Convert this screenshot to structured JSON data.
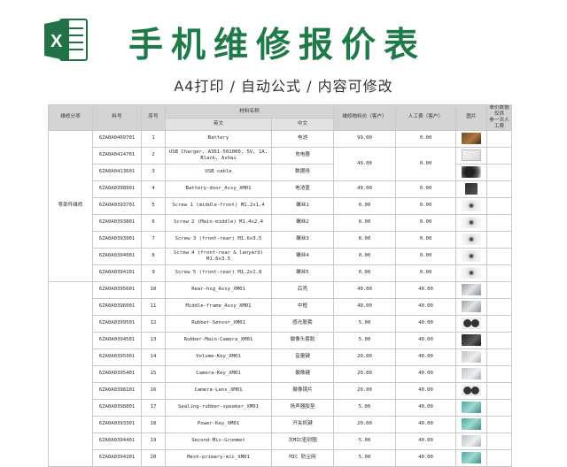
{
  "header": {
    "logo_letter": "X",
    "title": "手机维修报价表",
    "subtitle": "A4打印 / 自动公式 / 内容可修改"
  },
  "columns": {
    "category": "维修分项",
    "part_no": "料号",
    "seq": "序号",
    "material_name": "材料名称",
    "english": "英文",
    "chinese": "中文",
    "material_price": "维修物料价（客户）",
    "labor_fee": "人工费（客户）",
    "image": "图片",
    "note": "单价数据仅供\n参一次人工费"
  },
  "category_label": "零部件维修",
  "rows": [
    {
      "part_no": "6ZA0A0409701",
      "seq": "1",
      "en": "Battery",
      "cn": "电池",
      "price": "99.00",
      "labor": "0.00",
      "photo": "battery"
    },
    {
      "part_no": "6ZA0A0414701",
      "seq": "2",
      "en": "USB Charger, A361-501000, 5V, 1A, Black, Ashai",
      "cn": "充电器",
      "price": "49.00",
      "labor": "0.00",
      "photo": "charger"
    },
    {
      "part_no": "6ZA0A0413601",
      "seq": "3",
      "en": "USB cable",
      "cn": "数据线",
      "price": "",
      "labor": "",
      "photo": "cable"
    },
    {
      "part_no": "6ZA0A0398901",
      "seq": "4",
      "en": "Battery-door_Assy_XM01",
      "cn": "电池盖",
      "price": "49.00",
      "labor": "0.00",
      "photo": "door"
    },
    {
      "part_no": "6ZA0A0393701",
      "seq": "5",
      "en": "Screw 1 (middle-front) M1.2x1.4",
      "cn": "螺丝1",
      "price": "0.00",
      "labor": "0.00",
      "photo": "screw"
    },
    {
      "part_no": "6ZA0A0393801",
      "seq": "6",
      "en": "Screw 2 (Main-middle) M1.4x2.4",
      "cn": "螺丝2",
      "price": "0.00",
      "labor": "0.00",
      "photo": "screw"
    },
    {
      "part_no": "6ZA0A0393901",
      "seq": "7",
      "en": "Screw 3 (front-rear) M1.6x3.5",
      "cn": "螺丝3",
      "price": "0.00",
      "labor": "0.00",
      "photo": "screw"
    },
    {
      "part_no": "6ZA0A0394001",
      "seq": "8",
      "en": "Screw 4 (front-rear & lanyard) M1.6x3.5",
      "cn": "螺丝4",
      "price": "0.00",
      "labor": "0.00",
      "photo": "screw"
    },
    {
      "part_no": "6ZA0A0394101",
      "seq": "9",
      "en": "Screw 5 (front-rear) M1.2x1.8",
      "cn": "螺丝5",
      "price": "0.00",
      "labor": "0.00",
      "photo": "screw"
    },
    {
      "part_no": "6ZA0A0395601",
      "seq": "10",
      "en": "Rear-hsg_Assy_XM01",
      "cn": "后壳",
      "price": "40.00",
      "labor": "40.00",
      "photo": "metal"
    },
    {
      "part_no": "6ZA0A0396001",
      "seq": "11",
      "en": "Middle-frame_Assy_XM01",
      "cn": "中框",
      "price": "40.00",
      "labor": "40.00",
      "photo": "metal"
    },
    {
      "part_no": "6ZA0A0399501",
      "seq": "12",
      "en": "Rubber-Sensor_XM01",
      "cn": "感光胶套",
      "price": "5.00",
      "labor": "40.00",
      "photo": "rings"
    },
    {
      "part_no": "6ZA0A0394501",
      "seq": "13",
      "en": "Rubber-Main-Camera_XM01",
      "cn": "摄像头套胶",
      "price": "5.00",
      "labor": "40.00",
      "photo": "dark"
    },
    {
      "part_no": "6ZA0A0395301",
      "seq": "14",
      "en": "Volume-Key_XM01",
      "cn": "音量键",
      "price": "20.00",
      "labor": "40.00",
      "photo": "grey"
    },
    {
      "part_no": "6ZA0A0395401",
      "seq": "15",
      "en": "Camera-Key_XM01",
      "cn": "摄像键",
      "price": "20.00",
      "labor": "40.00",
      "photo": "grey"
    },
    {
      "part_no": "6ZA0A0398101",
      "seq": "16",
      "en": "Camera-Lens_XM01",
      "cn": "摄像镜片",
      "price": "20.00",
      "labor": "40.00",
      "photo": "rings"
    },
    {
      "part_no": "6ZA0A0398801",
      "seq": "17",
      "en": "Sealing-rubber-speaker_XM01",
      "cn": "扬声器胶垫",
      "price": "5.00",
      "labor": "40.00",
      "photo": "teal"
    },
    {
      "part_no": "6ZA0A0393301",
      "seq": "18",
      "en": "Power-Key_XM01",
      "cn": "开关机键",
      "price": "20.00",
      "labor": "40.00",
      "photo": "teal"
    },
    {
      "part_no": "6ZA0A0394401",
      "seq": "19",
      "en": "Second-Mic-Grommet",
      "cn": "次MIC密封圈",
      "price": "5.00",
      "labor": "40.00",
      "photo": "grey"
    },
    {
      "part_no": "6ZA0A0394201",
      "seq": "20",
      "en": "Mesh-primary-mic_XM01",
      "cn": "MIC 防尘网",
      "price": "5.00",
      "labor": "40.00",
      "photo": "teal"
    }
  ],
  "merged_row_values": {
    "price_2_3": "49.00",
    "labor_2_3": "0.00"
  },
  "colors": {
    "title_green": "#1e7a46",
    "header_grey": "#d4d4d4",
    "note_red": "#e03030",
    "excel_green": "#217346"
  }
}
